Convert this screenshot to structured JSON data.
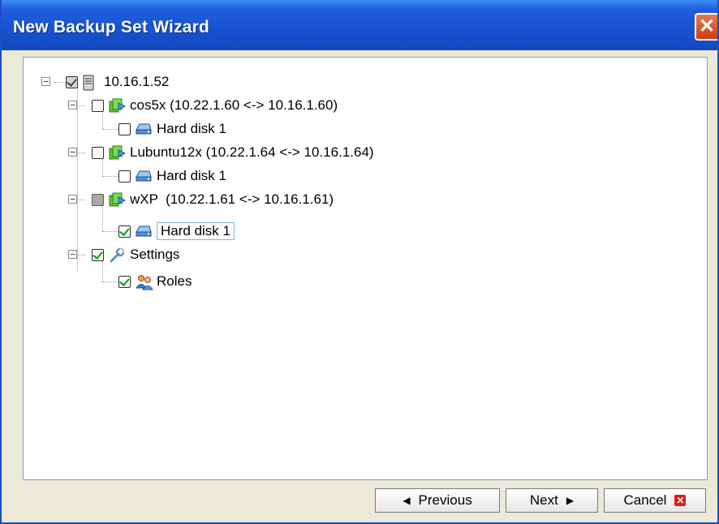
{
  "window": {
    "title": "New Backup Set Wizard"
  },
  "tree": {
    "root": {
      "label": "10.16.1.52",
      "checked": "checked"
    },
    "vms": [
      {
        "label": "cos5x (10.22.1.60 <-> 10.16.1.60)",
        "disk": "Hard disk 1",
        "vm_state": "unchecked",
        "disk_state": "unchecked"
      },
      {
        "label": "Lubuntu12x (10.22.1.64 <-> 10.16.1.64)",
        "disk": "Hard disk 1",
        "vm_state": "unchecked",
        "disk_state": "unchecked"
      },
      {
        "label": "wXP  (10.22.1.61 <-> 10.16.1.61)",
        "disk": "Hard disk 1",
        "vm_state": "partial",
        "disk_state": "checked"
      }
    ],
    "settings": {
      "label": "Settings",
      "checked": "checked",
      "child": "Roles",
      "child_checked": "checked"
    }
  },
  "buttons": {
    "previous": "Previous",
    "next": "Next",
    "cancel": "Cancel"
  }
}
